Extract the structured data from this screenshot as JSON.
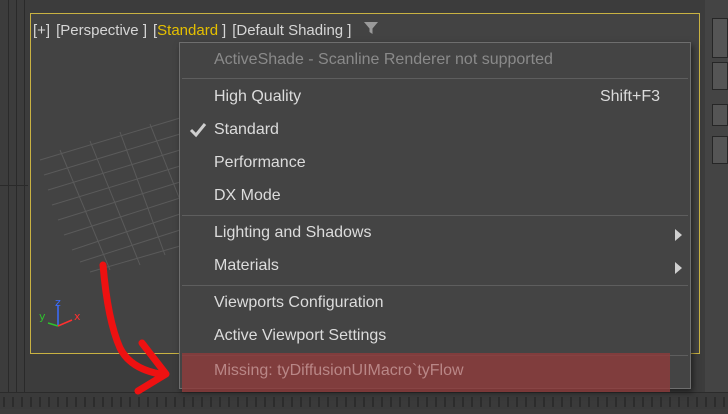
{
  "viewport": {
    "header": {
      "plus": "[+]",
      "perspective": "[Perspective ]",
      "shading_open": "[",
      "shading_current": "Standard",
      "shading_close": "]",
      "display_mode": "[Default Shading ]",
      "filter_icon": "filter-icon"
    },
    "gizmo": {
      "z": "z",
      "y": "y",
      "x": "x"
    }
  },
  "menu": {
    "items": [
      {
        "label": "ActiveShade - Scanline Renderer not supported",
        "disabled": true
      },
      {
        "label": "High Quality",
        "shortcut": "Shift+F3"
      },
      {
        "label": "Standard",
        "checked": true
      },
      {
        "label": "Performance"
      },
      {
        "label": "DX Mode"
      },
      {
        "label": "Lighting and Shadows",
        "submenu": true
      },
      {
        "label": "Materials",
        "submenu": true
      },
      {
        "label": "Viewports Configuration"
      },
      {
        "label": "Active Viewport Settings"
      },
      {
        "label": "Missing: tyDiffusionUIMacro`tyFlow",
        "disabled": true,
        "highlighted": true
      }
    ]
  },
  "colors": {
    "accent_yellow": "#e5c000",
    "viewport_border": "#c9b242",
    "menu_bg": "#444444",
    "highlight_red": "#8e3c3c",
    "annotation_red": "#ee1111"
  }
}
